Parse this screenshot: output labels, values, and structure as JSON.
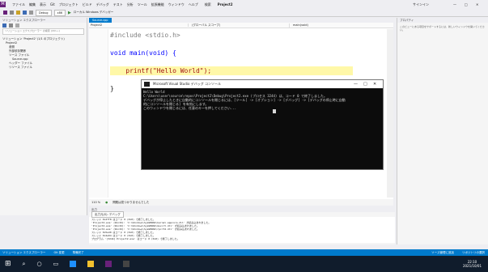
{
  "menu": [
    "ファイル",
    "編集",
    "表示",
    "Git",
    "プロジェクト",
    "ビルド",
    "デバッグ",
    "テスト",
    "分析",
    "ツール",
    "拡張機能",
    "ウィンドウ",
    "ヘルプ"
  ],
  "search_label": "検索",
  "project_name": "Project2",
  "toolbar": {
    "config": "Debug",
    "platform": "x86",
    "run_label": "ローカル Windows デバッガー"
  },
  "window_controls": {
    "user": "サインイン",
    "minimize": "—",
    "maximize": "□",
    "close": "✕"
  },
  "solution": {
    "title": "ソリューション エクスプローラー",
    "search_placeholder": "ソリューション エクスプローラー の検索 (Ctrl+;)",
    "items": [
      {
        "label": "ソリューション 'Project2' (1/1 のプロジェクト)",
        "indent": 0
      },
      {
        "label": "Project2",
        "indent": 1
      },
      {
        "label": "参照",
        "indent": 2
      },
      {
        "label": "外部依存関係",
        "indent": 2
      },
      {
        "label": "ソース ファイル",
        "indent": 2
      },
      {
        "label": "Source.cpp",
        "indent": 3
      },
      {
        "label": "ヘッダー ファイル",
        "indent": 2
      },
      {
        "label": "リソース ファイル",
        "indent": 2
      }
    ]
  },
  "editor": {
    "tab": "Source.cpp",
    "scope1": "Project2",
    "scope2": "(グローバル スコープ)",
    "scope3": "main(void)",
    "lines": [
      "#include <stdio.h>",
      "",
      "void main(void) {",
      "",
      "    printf(\"Hello World\");",
      "",
      "}"
    ],
    "zoom": "110 %",
    "issues": "問題は見つかりませんでした"
  },
  "console": {
    "title": "Microsoft Visual Studio デバッグ コンソール",
    "lines": [
      "Hello World",
      "C:\\Users\\user\\source\\repos\\Project2\\Debug\\Project2.exe (プロセス 3244) は、コード 0 で終了しました。",
      "デバッグが停止したときに自動的にコンソールを閉じるには、[ツール] -> [オプション] -> [デバッグ] -> [デバッグの停止時に自動",
      "的にコンソールを閉じる] を有効にします。",
      "このウィンドウを閉じるには、任意のキーを押してください..."
    ]
  },
  "output": {
    "title": "出力",
    "source_label": "出力元(S): デバッグ",
    "lines": [
      "スレッド 0x4ff8 はコード 0 (0x0) で終了しました。",
      "'Project2.exe' (Win32): 'C:\\Windows\\SysWOW64\\kernel.appcore.dll' が読み込まれました。",
      "'Project2.exe' (Win32): 'C:\\Windows\\SysWOW64\\msvcrt.dll' が読み込まれました。",
      "'Project2.exe' (Win32): 'C:\\Windows\\SysWOW64\\rpcrt4.dll' が読み込まれました。",
      "スレッド 0x5ed0 はコード 0 (0x0) で終了しました。",
      "スレッド 0x4e94 はコード 0 (0x0) で終了しました。",
      "プログラム '[3244] Project2.exe' はコード 0 (0x0) で終了しました。"
    ]
  },
  "props": {
    "title": "ソリューション エクスプローラー",
    "subtitle": "プロパティ",
    "msg": "このビューにある項目をサポートするには、新しいウィンドウを開いてください。"
  },
  "status": {
    "left": "ソリューション エクスプローラー",
    "git": "Git 変更",
    "ready": "準備完了",
    "add": "ソース管理に追加",
    "repo": "リポジトリの選択"
  },
  "taskbar": {
    "time": "22:10",
    "date": "2021/10/01"
  },
  "colors": {
    "accent": "#007acc",
    "vs_purple": "#68217a",
    "taskbar": "#101c2c",
    "keyword": "#0000ff",
    "string": "#a31515"
  }
}
